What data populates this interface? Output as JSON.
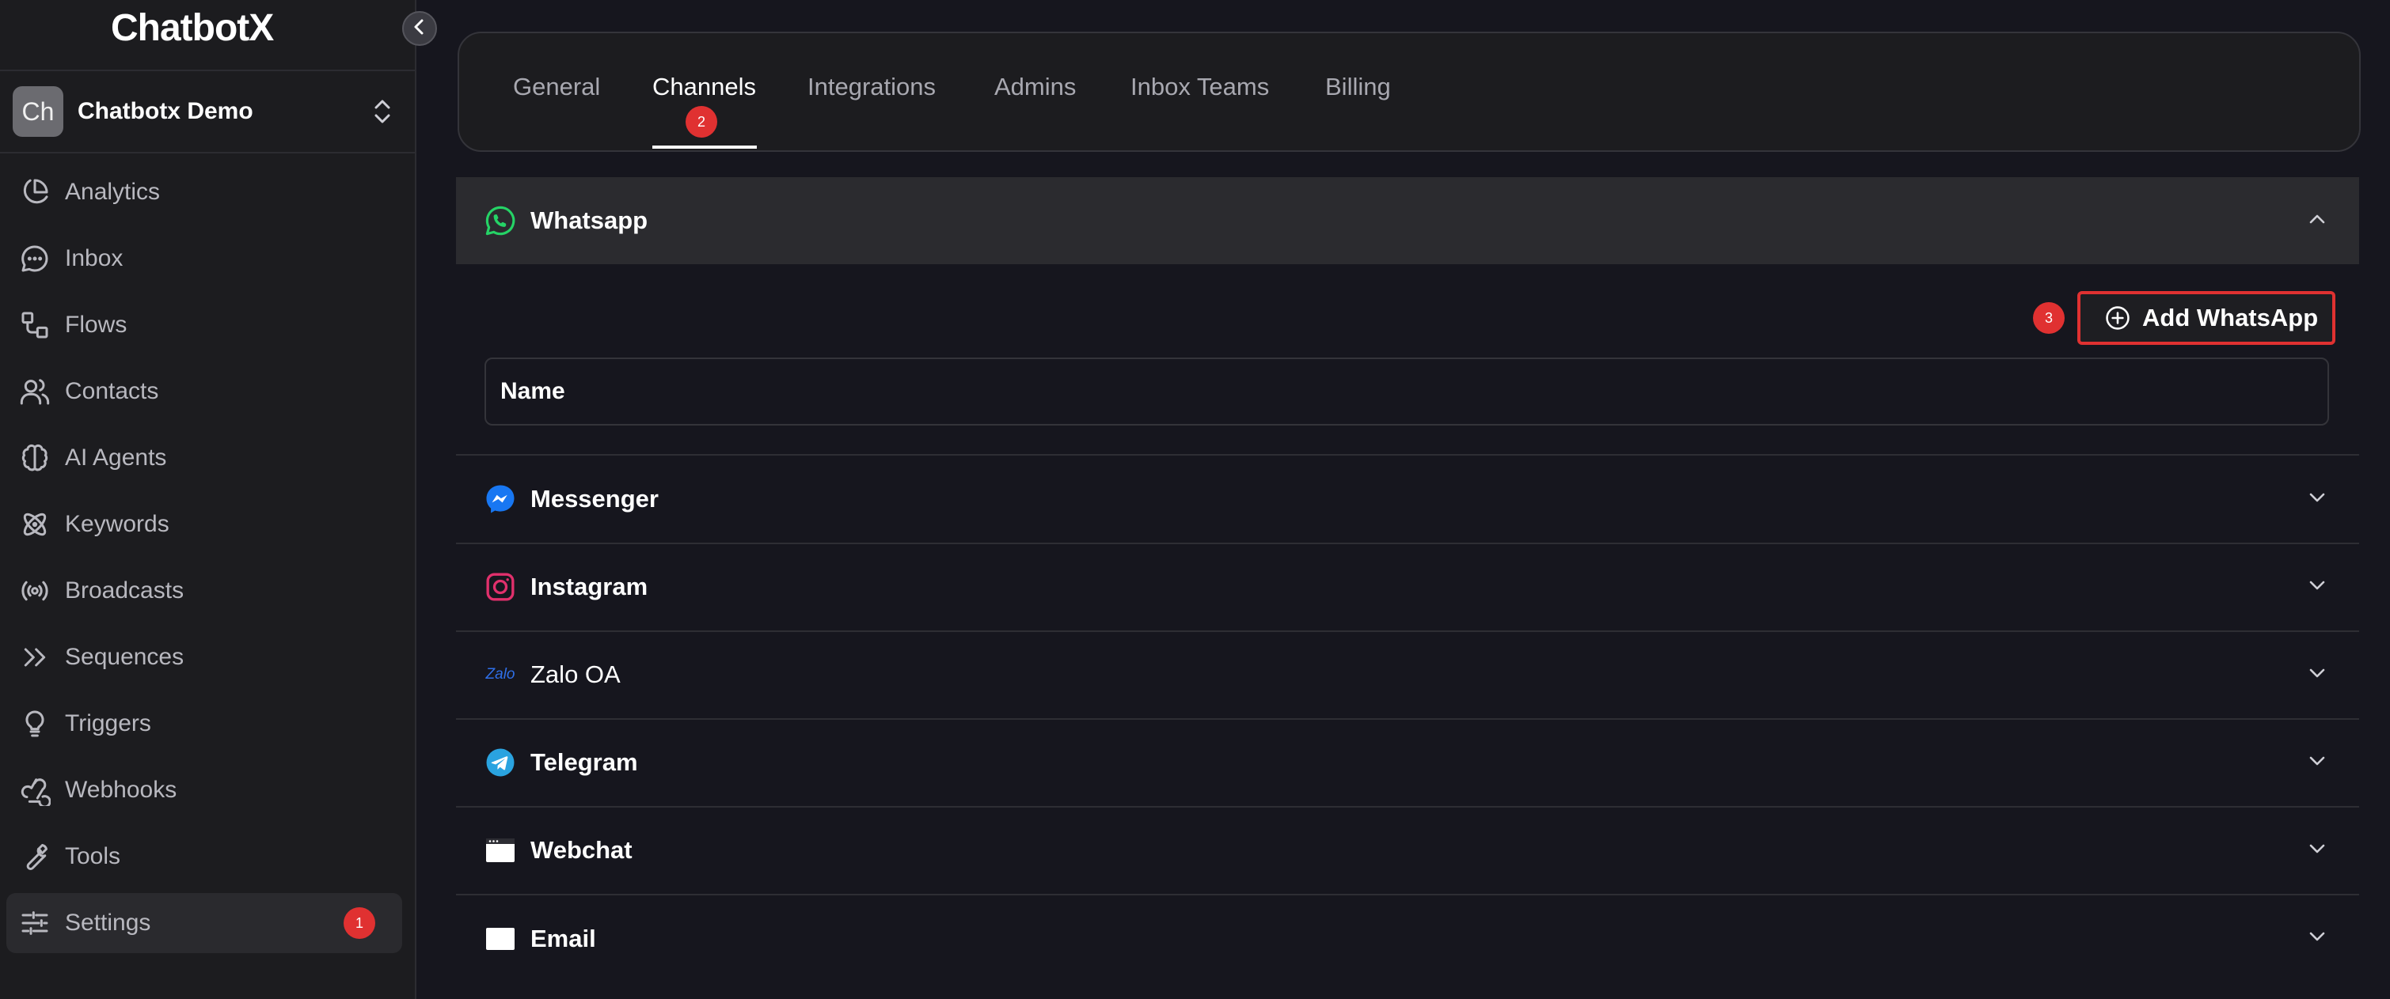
{
  "sidebar": {
    "logo": "ChatbotX",
    "workspace": {
      "avatar": "Ch",
      "name": "Chatbotx Demo"
    },
    "items": [
      {
        "label": "Analytics",
        "icon": "pie-chart-icon"
      },
      {
        "label": "Inbox",
        "icon": "chat-bubble-icon"
      },
      {
        "label": "Flows",
        "icon": "flows-icon"
      },
      {
        "label": "Contacts",
        "icon": "users-icon"
      },
      {
        "label": "AI Agents",
        "icon": "brain-icon"
      },
      {
        "label": "Keywords",
        "icon": "atom-icon"
      },
      {
        "label": "Broadcasts",
        "icon": "broadcast-icon"
      },
      {
        "label": "Sequences",
        "icon": "double-chevron-right-icon"
      },
      {
        "label": "Triggers",
        "icon": "lightbulb-icon"
      },
      {
        "label": "Webhooks",
        "icon": "webhook-icon"
      },
      {
        "label": "Tools",
        "icon": "wrench-icon"
      },
      {
        "label": "Settings",
        "icon": "sliders-icon",
        "active": true,
        "badge": "1"
      }
    ]
  },
  "tabs": {
    "items": [
      "General",
      "Channels",
      "Integrations",
      "Admins",
      "Inbox Teams",
      "Billing"
    ],
    "active": "Channels",
    "badge": "2"
  },
  "channels": {
    "whatsapp": {
      "title": "Whatsapp",
      "expanded": true,
      "add_button": "Add WhatsApp",
      "add_badge": "3",
      "table_header": "Name"
    },
    "sections": [
      {
        "title": "Messenger",
        "icon": "messenger-icon"
      },
      {
        "title": "Instagram",
        "icon": "instagram-icon"
      },
      {
        "title": "Zalo OA",
        "icon": "zalo-icon",
        "icon_text": "Zalo"
      },
      {
        "title": "Telegram",
        "icon": "telegram-icon"
      },
      {
        "title": "Webchat",
        "icon": "browser-window-icon"
      },
      {
        "title": "Email",
        "icon": "mail-icon"
      }
    ]
  },
  "colors": {
    "badge": "#e03131",
    "whatsapp": "#25d366",
    "messenger": "#1877f2",
    "instagram": "#e1306c",
    "telegram": "#2aa3e0",
    "zalo": "#2f6fe8"
  }
}
